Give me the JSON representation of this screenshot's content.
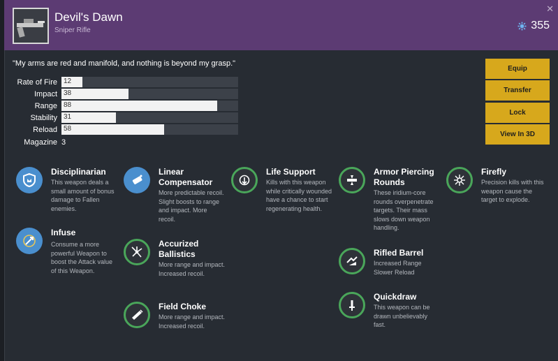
{
  "item": {
    "name": "Devil's Dawn",
    "type": "Sniper Rifle",
    "light": "355",
    "quote": "\"My arms are red and manifold, and nothing is beyond my grasp.\"",
    "close_label": "✕"
  },
  "stats": [
    {
      "label": "Rate of Fire",
      "value": "12",
      "fraction": 0.12
    },
    {
      "label": "Impact",
      "value": "38",
      "fraction": 0.38
    },
    {
      "label": "Range",
      "value": "88",
      "fraction": 0.88
    },
    {
      "label": "Stability",
      "value": "31",
      "fraction": 0.31
    },
    {
      "label": "Reload",
      "value": "58",
      "fraction": 0.58
    }
  ],
  "magazine": {
    "label": "Magazine",
    "value": "3"
  },
  "actions": {
    "equip": "Equip",
    "transfer": "Transfer",
    "lock": "Lock",
    "view3d": "View In 3D"
  },
  "perks": {
    "disciplinarian": {
      "name": "Disciplinarian",
      "desc": "This weapon deals a small amount of bonus damage to Fallen enemies.",
      "icon": "shield-icon"
    },
    "infuse": {
      "name": "Infuse",
      "desc": "Consume a more powerful Weapon to boost the Attack value of this Weapon.",
      "icon": "infuse-icon"
    },
    "linear_compensator": {
      "name": "Linear Compensator",
      "desc": "More predictable recoil. Slight boosts to range and impact. More recoil.",
      "icon": "barrel-icon"
    },
    "accurized_ballistics": {
      "name": "Accurized Ballistics",
      "desc": "More range and impact. Increased recoil.",
      "icon": "ballistics-icon"
    },
    "field_choke": {
      "name": "Field Choke",
      "desc": "More range and impact. Increased recoil.",
      "icon": "choke-icon"
    },
    "life_support": {
      "name": "Life Support",
      "desc": "Kills with this weapon while critically wounded have a chance to start regenerating health.",
      "icon": "life-support-icon"
    },
    "armor_piercing": {
      "name": "Armor Piercing Rounds",
      "desc": "These iridium-core rounds overpenetrate targets. Their mass slows down weapon handling.",
      "icon": "armor-piercing-icon"
    },
    "rifled_barrel": {
      "name": "Rifled Barrel",
      "desc": "Increased Range Slower Reload",
      "icon": "rifled-barrel-icon"
    },
    "quickdraw": {
      "name": "Quickdraw",
      "desc": "This weapon can be drawn unbelievably fast.",
      "icon": "quickdraw-icon"
    },
    "firefly": {
      "name": "Firefly",
      "desc": "Precision kills with this weapon cause the target to explode.",
      "icon": "firefly-icon"
    }
  },
  "colors": {
    "header": "#5c3b73",
    "button": "#d7a81c",
    "perk_blue": "#4a8fce",
    "perk_green": "#4aa65a"
  }
}
